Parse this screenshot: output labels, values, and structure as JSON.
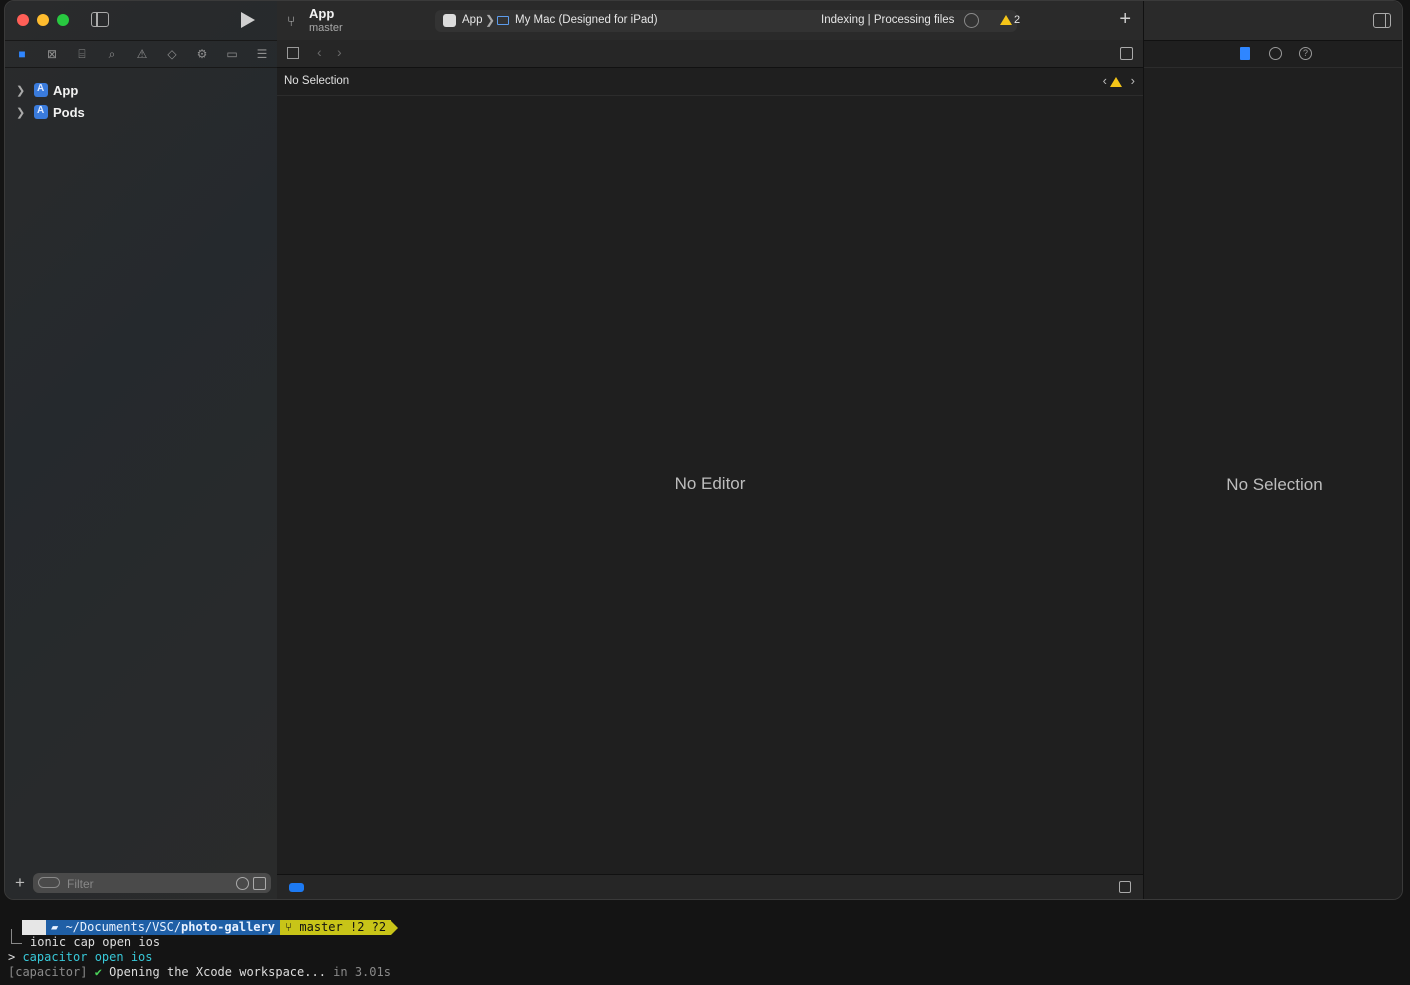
{
  "toolbar": {
    "project_name": "App",
    "branch": "master",
    "scheme": "App",
    "destination": "My Mac (Designed for iPad)",
    "status": "Indexing | Processing files",
    "warning_count": "2"
  },
  "navigator": {
    "items": [
      {
        "label": "App"
      },
      {
        "label": "Pods"
      }
    ],
    "filter_placeholder": "Filter"
  },
  "editor": {
    "jump_label": "No Selection",
    "empty_text": "No Editor"
  },
  "inspector": {
    "empty_text": "No Selection"
  },
  "terminal": {
    "path_prefix": "~/Documents/VSC/",
    "path_bold": "photo-gallery",
    "git_status": "master !2 ?2",
    "command": "ionic cap open ios",
    "line2_prompt": "> ",
    "line2_cmd": "capacitor open ios",
    "line3_tag": "[capacitor]",
    "line3_check": "✔",
    "line3_msg": " Opening the Xcode workspace...",
    "line3_time": " in 3.01s"
  },
  "icons": {
    "navigator_tabs": [
      "folder-icon",
      "source-control-icon",
      "symbol-icon",
      "find-icon",
      "issue-icon",
      "test-icon",
      "debug-icon",
      "breakpoint-icon",
      "report-icon"
    ]
  },
  "colors": {
    "accent": "#2f86ff",
    "warning": "#f5c518",
    "path_segment": "#1f5fa6",
    "git_segment": "#c8c418"
  }
}
